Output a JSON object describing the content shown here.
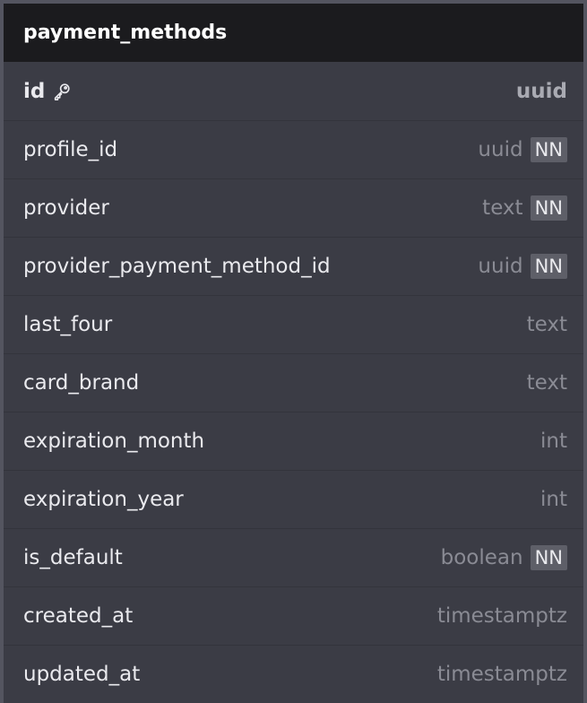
{
  "table": {
    "name": "payment_methods",
    "columns": [
      {
        "name": "id",
        "type": "uuid",
        "primary_key": true,
        "not_null": false,
        "nn_label": ""
      },
      {
        "name": "profile_id",
        "type": "uuid",
        "primary_key": false,
        "not_null": true,
        "nn_label": "NN"
      },
      {
        "name": "provider",
        "type": "text",
        "primary_key": false,
        "not_null": true,
        "nn_label": "NN"
      },
      {
        "name": "provider_payment_method_id",
        "type": "uuid",
        "primary_key": false,
        "not_null": true,
        "nn_label": "NN"
      },
      {
        "name": "last_four",
        "type": "text",
        "primary_key": false,
        "not_null": false,
        "nn_label": ""
      },
      {
        "name": "card_brand",
        "type": "text",
        "primary_key": false,
        "not_null": false,
        "nn_label": ""
      },
      {
        "name": "expiration_month",
        "type": "int",
        "primary_key": false,
        "not_null": false,
        "nn_label": ""
      },
      {
        "name": "expiration_year",
        "type": "int",
        "primary_key": false,
        "not_null": false,
        "nn_label": ""
      },
      {
        "name": "is_default",
        "type": "boolean",
        "primary_key": false,
        "not_null": true,
        "nn_label": "NN"
      },
      {
        "name": "created_at",
        "type": "timestamptz",
        "primary_key": false,
        "not_null": false,
        "nn_label": ""
      },
      {
        "name": "updated_at",
        "type": "timestamptz",
        "primary_key": false,
        "not_null": false,
        "nn_label": ""
      }
    ]
  },
  "icons": {
    "primary_key": "key-icon"
  },
  "colors": {
    "header_bg": "#1b1b1e",
    "body_bg": "#3b3c45",
    "badge_bg": "#5e5f68"
  }
}
